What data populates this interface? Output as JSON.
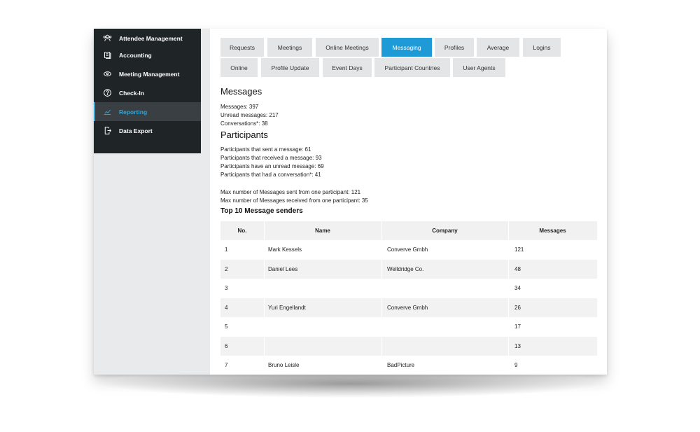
{
  "sidebar": {
    "items": [
      {
        "label": "Attendee Management",
        "icon": "users-icon",
        "active": false
      },
      {
        "label": "Accounting",
        "icon": "coins-icon",
        "active": false
      },
      {
        "label": "Meeting Management",
        "icon": "meeting-icon",
        "active": false
      },
      {
        "label": "Check-In",
        "icon": "help-circle-icon",
        "active": false
      },
      {
        "label": "Reporting",
        "icon": "chart-icon",
        "active": true
      },
      {
        "label": "Data Export",
        "icon": "export-icon",
        "active": false
      }
    ]
  },
  "tabs": {
    "row1": [
      "Requests",
      "Meetings",
      "Online Meetings",
      "Messaging",
      "Profiles",
      "Average",
      "Logins"
    ],
    "row2": [
      "Online",
      "Profile Update",
      "Event Days",
      "Participant Countries",
      "User Agents"
    ],
    "active": "Messaging"
  },
  "messages": {
    "heading": "Messages",
    "stats": [
      "Messages: 397",
      "Unread messages: 217",
      "Conversations*: 38"
    ]
  },
  "participants": {
    "heading": "Participants",
    "stats": [
      "Participants that sent a message: 61",
      "Participants that received a message: 93",
      "Participants have an unread message: 69",
      "Participants that had a conversation*: 41"
    ],
    "max_stats": [
      "Max number of Messages sent from one participant: 121",
      "Max number of Messages received from one participant: 35"
    ]
  },
  "top_senders": {
    "heading": "Top 10 Message senders",
    "columns": [
      "No.",
      "Name",
      "Company",
      "Messages"
    ],
    "rows": [
      [
        "1",
        "Mark Kessels",
        "Converve Gmbh",
        "121"
      ],
      [
        "2",
        "Daniel Lees",
        "Welldridge Co.",
        "48"
      ],
      [
        "3",
        "",
        "",
        "34"
      ],
      [
        "4",
        "Yuri Engellandt",
        "Converve Gmbh",
        "26"
      ],
      [
        "5",
        "",
        "",
        "17"
      ],
      [
        "6",
        "",
        "",
        "13"
      ],
      [
        "7",
        "Bruno Leisle",
        "BadPicture",
        "9"
      ]
    ]
  },
  "colors": {
    "accent": "#1e9ad6",
    "sidebar_bg": "#1f2427",
    "sidebar_active_text": "#2fa6da"
  }
}
